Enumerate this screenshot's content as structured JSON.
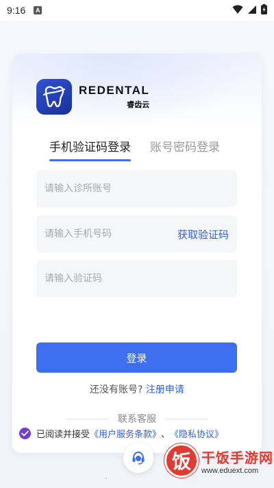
{
  "status_bar": {
    "time": "9:16",
    "notification_letter": "A"
  },
  "brand": {
    "name_en": "REDENTAL",
    "name_cn": "睿齿云"
  },
  "tabs": [
    {
      "label": "手机验证码登录",
      "active": true
    },
    {
      "label": "账号密码登录",
      "active": false
    }
  ],
  "form": {
    "clinic_placeholder": "请输入诊所账号",
    "phone_placeholder": "请输入手机号码",
    "get_code_label": "获取验证码",
    "code_placeholder": "请输入验证码",
    "login_label": "登录"
  },
  "register": {
    "prompt": "还没有账号?",
    "link": "注册申请"
  },
  "support": {
    "label": "联系客服"
  },
  "agreement": {
    "checked": true,
    "prefix": "已阅读并接受",
    "terms": "《用户服务条款》",
    "separator": "、",
    "privacy": "《隐私协议》"
  },
  "watermark": {
    "logo_char": "饭",
    "title": "干饭手游网",
    "url": "www.eduext.com"
  },
  "colors": {
    "primary": "#3d6ef0",
    "link": "#2f5fe6",
    "checkbox": "#6f3fd6",
    "watermark": "#e23a2f"
  }
}
